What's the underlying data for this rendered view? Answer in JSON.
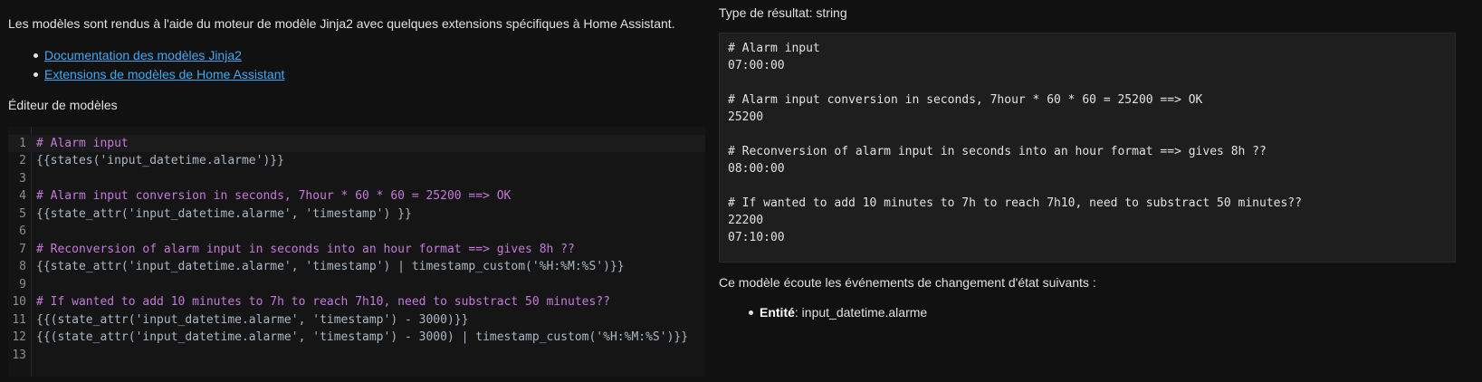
{
  "intro_text": "Les modèles sont rendus à l'aide du moteur de modèle Jinja2 avec quelques extensions spécifiques à Home Assistant.",
  "links": [
    {
      "label": "Documentation des modèles Jinja2"
    },
    {
      "label": "Extensions de modèles de Home Assistant"
    }
  ],
  "editor_title": "Éditeur de modèles",
  "editor": {
    "active_line": 1,
    "lines": [
      {
        "no": "1",
        "text": "# Alarm input"
      },
      {
        "no": "2",
        "text": "{{states('input_datetime.alarme')}}"
      },
      {
        "no": "3",
        "text": ""
      },
      {
        "no": "4",
        "text": "# Alarm input conversion in seconds, 7hour * 60 * 60 = 25200 ==> OK"
      },
      {
        "no": "5",
        "text": "{{state_attr('input_datetime.alarme', 'timestamp') }}"
      },
      {
        "no": "6",
        "text": ""
      },
      {
        "no": "7",
        "text": "# Reconversion of alarm input in seconds into an hour format ==> gives 8h ??"
      },
      {
        "no": "8",
        "text": "{{state_attr('input_datetime.alarme', 'timestamp') | timestamp_custom('%H:%M:%S')}}"
      },
      {
        "no": "9",
        "text": ""
      },
      {
        "no": "10",
        "text": "# If wanted to add 10 minutes to 7h to reach 7h10, need to substract 50 minutes??"
      },
      {
        "no": "11",
        "text": "{{(state_attr('input_datetime.alarme', 'timestamp') - 3000)}}"
      },
      {
        "no": "12",
        "text": "{{(state_attr('input_datetime.alarme', 'timestamp') - 3000) | timestamp_custom('%H:%M:%S')}}"
      },
      {
        "no": "13",
        "text": ""
      }
    ]
  },
  "result_type": "Type de résultat: string",
  "result_lines": [
    "# Alarm input",
    "07:00:00",
    "",
    "# Alarm input conversion in seconds, 7hour * 60 * 60 = 25200 ==> OK",
    "25200",
    "",
    "# Reconversion of alarm input in seconds into an hour format ==> gives 8h ??",
    "08:00:00",
    "",
    "# If wanted to add 10 minutes to 7h to reach 7h10, need to substract 50 minutes??",
    "22200",
    "07:10:00"
  ],
  "listen_text": "Ce modèle écoute les événements de changement d'état suivants :",
  "entity_label": "Entité",
  "entity_value": ": input_datetime.alarme",
  "colors": {
    "link": "#3fa9f5",
    "background": "#111111",
    "result_bg": "#1e1e1e"
  }
}
